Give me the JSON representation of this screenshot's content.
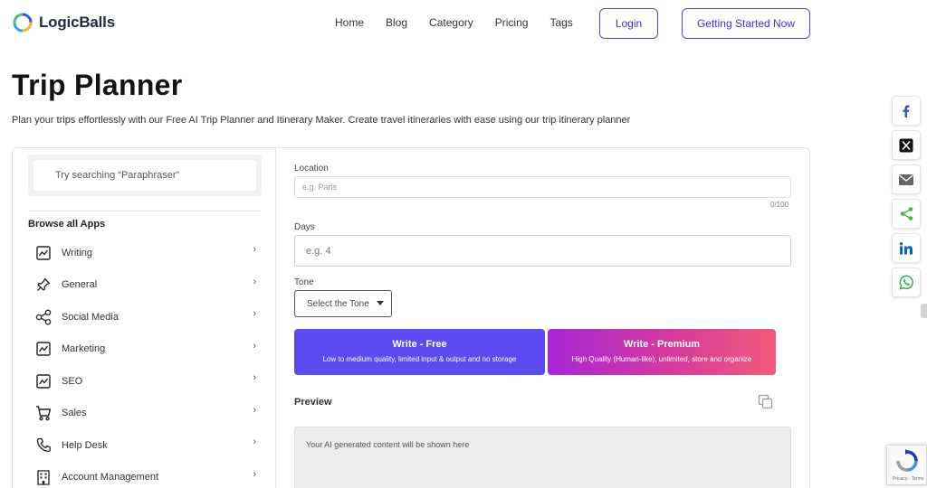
{
  "header": {
    "logo_text": "LogicBalls",
    "nav": [
      "Home",
      "Blog",
      "Category",
      "Pricing",
      "Tags"
    ],
    "login_label": "Login",
    "start_label": "Getting Started Now"
  },
  "page": {
    "title": "Trip Planner",
    "description": "Plan your trips effortlessly with our Free AI Trip Planner and Itinerary Maker. Create travel itineraries with ease using our trip itinerary planner"
  },
  "sidebar": {
    "search_placeholder": "Try searching “Paraphraser”",
    "browse_title": "Browse all Apps",
    "items": [
      {
        "label": "Writing",
        "icon": "chart-line-icon"
      },
      {
        "label": "General",
        "icon": "pin-icon"
      },
      {
        "label": "Social Media",
        "icon": "share-nodes-icon"
      },
      {
        "label": "Marketing",
        "icon": "chart-line-icon"
      },
      {
        "label": "SEO",
        "icon": "chart-line-icon"
      },
      {
        "label": "Sales",
        "icon": "cart-icon"
      },
      {
        "label": "Help Desk",
        "icon": "phone-icon"
      },
      {
        "label": "Account Management",
        "icon": "building-icon"
      }
    ]
  },
  "form": {
    "location_label": "Location",
    "location_placeholder": "e.g. Paris",
    "location_counter": "0/100",
    "days_label": "Days",
    "days_placeholder": "e.g. 4",
    "tone_label": "Tone",
    "tone_selected": "Select the Tone",
    "write_free_title": "Write - Free",
    "write_free_sub": "Low to medium quality, limited input & output and no storage",
    "write_premium_title": "Write - Premium",
    "write_premium_sub": "High Quality (Human-like), unlimited, store and organize",
    "preview_label": "Preview",
    "preview_placeholder": "Your AI generated content will be shown here"
  },
  "share": [
    "facebook-icon",
    "x-icon",
    "email-icon",
    "share-icon",
    "linkedin-icon",
    "whatsapp-icon"
  ],
  "recaptcha": {
    "terms": "Privacy - Terms"
  },
  "colors": {
    "accent": "#5b4bf0",
    "premium_start": "#a726d6",
    "premium_end": "#f35a7a"
  }
}
